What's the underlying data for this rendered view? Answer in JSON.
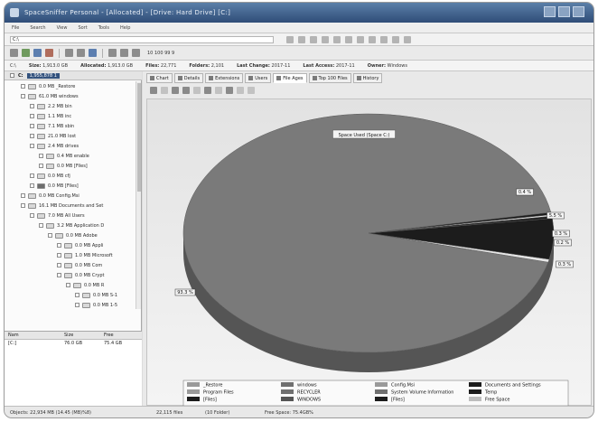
{
  "window": {
    "title": "SpaceSniffer Personal - [Allocated] - [Drive: Hard Drive] [C:]"
  },
  "menu": [
    "File",
    "Search",
    "View",
    "Sort",
    "Tools",
    "Help"
  ],
  "address": {
    "value": "C:\\"
  },
  "toolbar": {
    "zoom_label": "10 100 99 9"
  },
  "infobar": {
    "path": "C:\\",
    "size_label": "Size:",
    "size_value": "1,913.0 GB",
    "allocated_label": "Allocated:",
    "allocated_value": "1,913.0 GB",
    "files_label": "Files:",
    "files_value": "22,771",
    "folders_label": "Folders:",
    "folders_value": "2,101",
    "last_change_label": "Last Change:",
    "last_change_value": "2017-11",
    "last_access_label": "Last Access:",
    "last_access_value": "2017-11",
    "owner_label": "Owner:",
    "owner_value": "Windows"
  },
  "tree": {
    "drive_label": "C:",
    "drive_size": "1,955,878 1",
    "rows": [
      {
        "size": "0.0 MB",
        "name": "_Restore",
        "depth": 1,
        "expanded": false,
        "dark": false
      },
      {
        "size": "61.0 MB",
        "name": "windows",
        "depth": 1,
        "expanded": true,
        "dark": false
      },
      {
        "size": "2.2 MB",
        "name": "bin",
        "depth": 2,
        "expanded": false,
        "dark": false
      },
      {
        "size": "1.1 MB",
        "name": "inc",
        "depth": 2,
        "expanded": false,
        "dark": false
      },
      {
        "size": "7.1 MB",
        "name": "sbin",
        "depth": 2,
        "expanded": false,
        "dark": false
      },
      {
        "size": "21.0 MB",
        "name": "lost",
        "depth": 2,
        "expanded": false,
        "dark": false
      },
      {
        "size": "2.4 MB",
        "name": "drives",
        "depth": 2,
        "expanded": true,
        "dark": false
      },
      {
        "size": "0.4 MB",
        "name": "enable",
        "depth": 3,
        "expanded": false,
        "dark": false
      },
      {
        "size": "0.0 MB",
        "name": "[Files]",
        "depth": 3,
        "expanded": false,
        "dark": false
      },
      {
        "size": "0.0 MB",
        "name": "cfj",
        "depth": 2,
        "expanded": false,
        "dark": false
      },
      {
        "size": "0.0 MB",
        "name": "[Files]",
        "depth": 2,
        "expanded": false,
        "dark": true
      },
      {
        "size": "0.0 MB",
        "name": "Config.Msi",
        "depth": 1,
        "expanded": false,
        "dark": false
      },
      {
        "size": "16.1 MB",
        "name": "Documents and Set",
        "depth": 1,
        "expanded": true,
        "dark": false
      },
      {
        "size": "7.0 MB",
        "name": "All Users",
        "depth": 2,
        "expanded": true,
        "dark": false
      },
      {
        "size": "3.2 MB",
        "name": "Application D",
        "depth": 3,
        "expanded": true,
        "dark": false
      },
      {
        "size": "0.0 MB",
        "name": "Adobe",
        "depth": 4,
        "expanded": false,
        "dark": false
      },
      {
        "size": "0.0 MB",
        "name": "Appli",
        "depth": 5,
        "expanded": false,
        "dark": false
      },
      {
        "size": "1.0 MB",
        "name": "Microsoft",
        "depth": 5,
        "expanded": false,
        "dark": false
      },
      {
        "size": "0.0 MB",
        "name": "Com",
        "depth": 5,
        "expanded": false,
        "dark": false
      },
      {
        "size": "0.0 MB",
        "name": "Crypt",
        "depth": 5,
        "expanded": false,
        "dark": false
      },
      {
        "size": "0.0 MB",
        "name": "R",
        "depth": 6,
        "expanded": false,
        "dark": false
      },
      {
        "size": "0.0 MB",
        "name": "S-1",
        "depth": 7,
        "expanded": false,
        "dark": false
      },
      {
        "size": "0.0 MB",
        "name": "1-5",
        "depth": 7,
        "expanded": false,
        "dark": false
      }
    ]
  },
  "list": {
    "headers": [
      "Nam",
      "Size",
      "Free"
    ],
    "rows": [
      {
        "name": "[C:]",
        "size": "76.0 GB",
        "free": "75.4 GB"
      }
    ]
  },
  "tabs": [
    {
      "label": "Chart",
      "active": false
    },
    {
      "label": "Details",
      "active": false
    },
    {
      "label": "Extensions",
      "active": false
    },
    {
      "label": "Users",
      "active": false
    },
    {
      "label": "File Ages",
      "active": true
    },
    {
      "label": "Top 100 Files",
      "active": false
    },
    {
      "label": "History",
      "active": false
    }
  ],
  "colors": {
    "pie_main": "#7a7a7a",
    "pie_side": "#555555",
    "pie_dark": "#1c1c1c",
    "pie_light": "#e6e6e6",
    "title_bar": "#3a5a86"
  },
  "chart_data": {
    "type": "pie",
    "title": "Space Used (Space C:)",
    "slices": [
      {
        "label": "93.3 %",
        "value": 93.3
      },
      {
        "label": "0.4 %",
        "value": 0.4
      },
      {
        "label": "5.5 %",
        "value": 5.5
      },
      {
        "label": "0.3 %",
        "value": 0.3
      },
      {
        "label": "0.2 %",
        "value": 0.2
      },
      {
        "label": "0.3 %",
        "value": 0.3
      }
    ],
    "legend": [
      "_Restore",
      "windows",
      "Config.Msi",
      "Documents and Settings",
      "Program Files",
      "RECYCLER",
      "System Volume Information",
      "Temp",
      "[Files]",
      "WINDOWS",
      "[Files]",
      "Free Space"
    ],
    "legend_position": "bottom"
  },
  "status": {
    "left": "Objects: 22,934 MB (14.45 (MB)%8)",
    "mid1": "22,115 files",
    "mid2": "(10 Folder)",
    "right": "Free Space: 75.4GB%"
  }
}
